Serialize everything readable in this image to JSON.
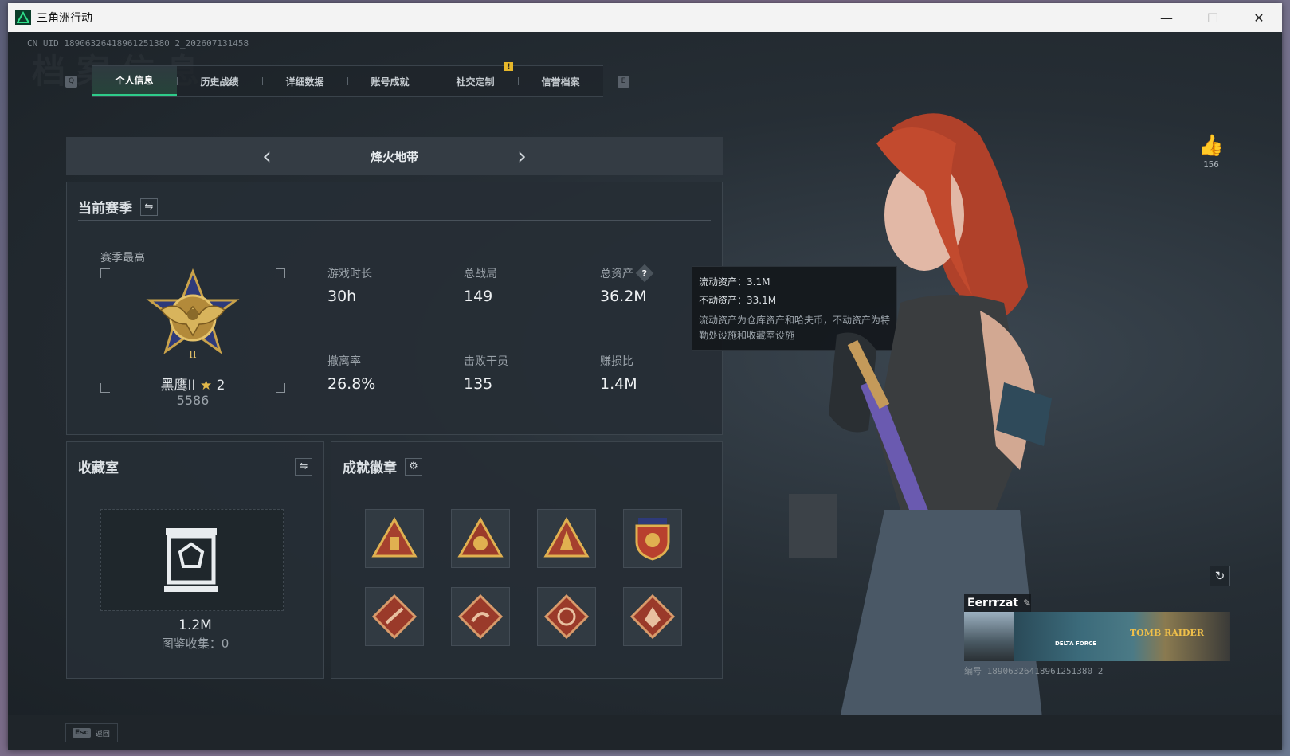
{
  "window": {
    "title": "三角洲行动"
  },
  "controls": {
    "minimize": "—",
    "maximize": "☐",
    "close": "✕"
  },
  "header": {
    "uid": "CN UID 18906326418961251380 2_202607131458",
    "bg_text": "档案信息"
  },
  "tabs": {
    "prev_key": "Q",
    "next_key": "E",
    "alert": "!",
    "items": [
      {
        "label": "个人信息",
        "active": true
      },
      {
        "label": "历史战绩"
      },
      {
        "label": "详细数据"
      },
      {
        "label": "账号成就"
      },
      {
        "label": "社交定制"
      },
      {
        "label": "信誉档案"
      }
    ]
  },
  "mode": {
    "title": "烽火地带",
    "prev": "‹",
    "next": "›"
  },
  "season": {
    "title": "当前赛季",
    "switch_icon": "⇋",
    "best_label": "赛季最高",
    "rank_name": "黑鹰II",
    "rank_star": "★",
    "rank_stars": "2",
    "rank_score": "5586",
    "stats": [
      {
        "label": "游戏时长",
        "value": "30h"
      },
      {
        "label": "总战局",
        "value": "149"
      },
      {
        "label": "总资产",
        "value": "36.2M",
        "help": "?"
      },
      {
        "label": "撤离率",
        "value": "26.8%"
      },
      {
        "label": "击败干员",
        "value": "135"
      },
      {
        "label": "赚损比",
        "value": "1.4M"
      }
    ]
  },
  "tooltip": {
    "liquid": "流动资产：3.1M",
    "fixed": "不动资产：33.1M",
    "desc": "流动资产为仓库资产和哈夫币，不动资产为特勤处设施和收藏室设施"
  },
  "collection": {
    "title": "收藏室",
    "switch_icon": "⇋",
    "value": "1.2M",
    "count": "图鉴收集：0"
  },
  "achievements": {
    "title": "成就徽章",
    "settings_icon": "⚙",
    "badges": [
      "badge-1",
      "badge-2",
      "badge-3",
      "badge-4",
      "badge-5",
      "badge-6",
      "badge-7",
      "badge-8"
    ]
  },
  "likes": {
    "icon": "👍",
    "count": "156"
  },
  "player": {
    "name": "Eerrrzat",
    "edit_icon": "✎",
    "id": "编号 18906326418961251380 2",
    "banner_brand": "DELTA FORCE",
    "banner_brand2": "TOMB RAIDER"
  },
  "refresh_icon": "↻",
  "footer": {
    "esc_key": "Esc",
    "back_label": "返回"
  }
}
